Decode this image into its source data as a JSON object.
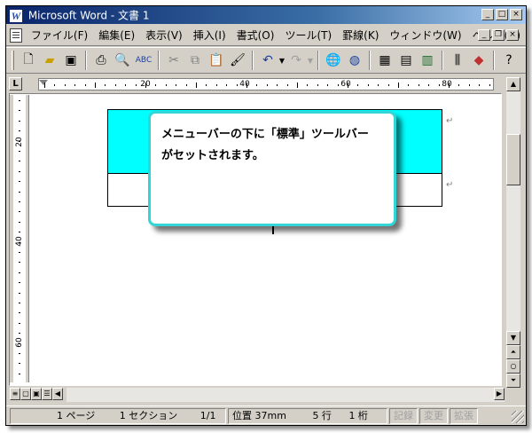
{
  "window": {
    "title": "Microsoft Word - 文書 1",
    "app_icon": "W",
    "controls": [
      "minimize-icon",
      "maximize-icon",
      "close-icon"
    ]
  },
  "menubar": {
    "items": [
      {
        "label": "ファイル(F)"
      },
      {
        "label": "編集(E)"
      },
      {
        "label": "表示(V)"
      },
      {
        "label": "挿入(I)"
      },
      {
        "label": "書式(O)"
      },
      {
        "label": "ツール(T)"
      },
      {
        "label": "罫線(K)"
      },
      {
        "label": "ウィンドウ(W)"
      },
      {
        "label": "ヘルプ(H)"
      }
    ]
  },
  "toolbar": {
    "name": "標準",
    "icons": [
      "new-icon",
      "open-icon",
      "save-icon",
      "print-icon",
      "print-preview-icon",
      "spelling-icon",
      "cut-icon",
      "copy-icon",
      "paste-icon",
      "format-painter-icon",
      "undo-icon",
      "redo-icon",
      "hyperlink-icon",
      "web-toolbar-icon",
      "tables-borders-icon",
      "insert-table-icon",
      "insert-excel-icon",
      "columns-icon",
      "drawing-icon",
      "help-icon"
    ]
  },
  "ruler": {
    "marks": [
      "20",
      "40",
      "60",
      "80"
    ],
    "vertical_marks": [
      "20",
      "40",
      "60"
    ]
  },
  "callout": {
    "text_line1": "メニューバーの下に「標準」ツールバー",
    "text_line2": "がセットされます。"
  },
  "statusbar": {
    "page": "1 ページ",
    "section": "1 セクション",
    "pages": "1/1",
    "position": "位置 37mm",
    "line": "5 行",
    "column": "1 桁",
    "rec": "記録",
    "trk": "変更",
    "ext": "拡張"
  },
  "colors": {
    "table_header_fill": "#00ffff",
    "callout_border": "#33d6d6",
    "titlebar_start": "#0a246a"
  }
}
